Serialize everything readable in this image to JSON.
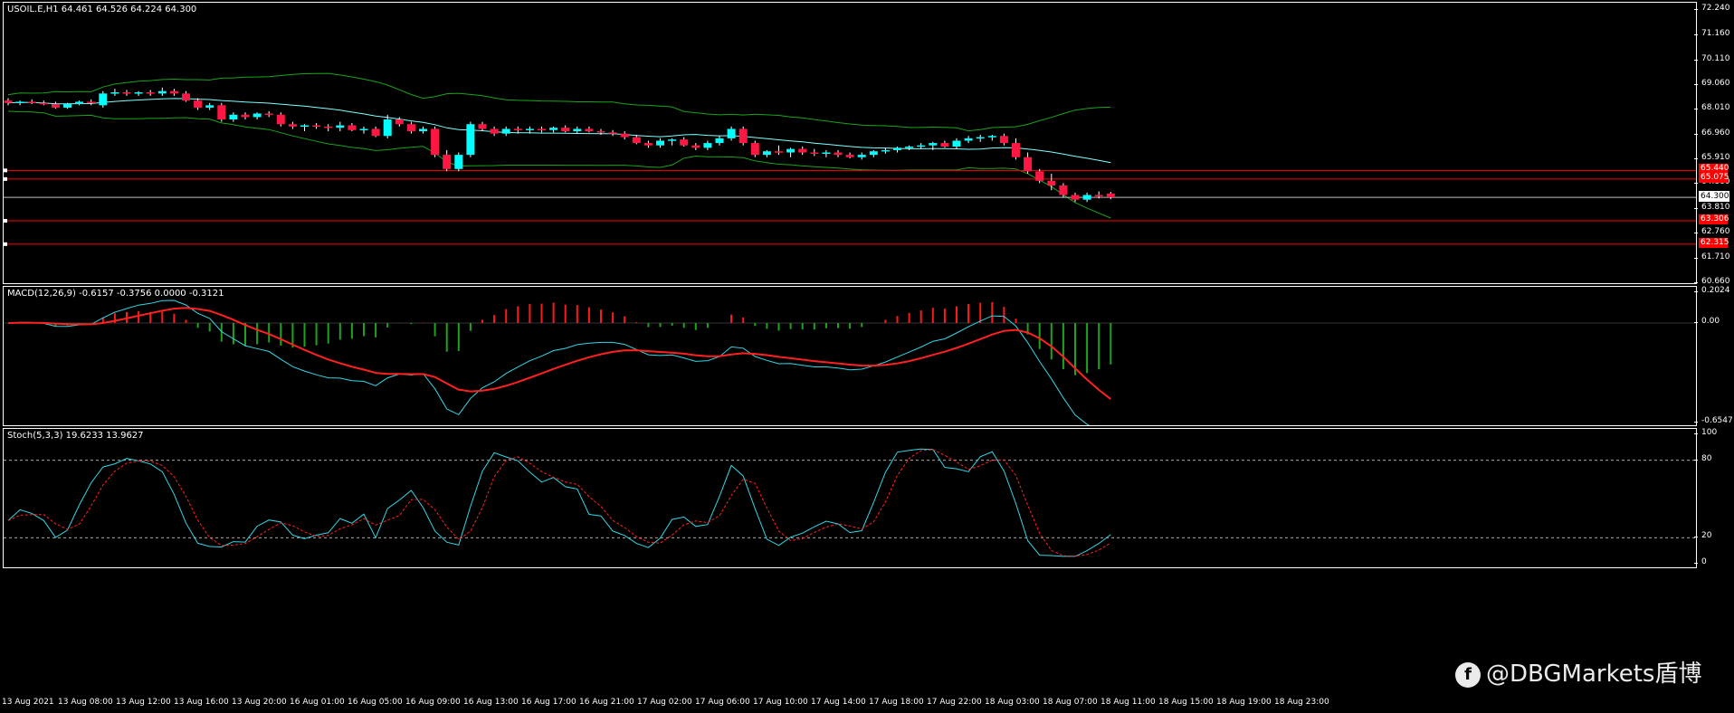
{
  "main": {
    "symbol_line": "USOIL.E,H1  64.461 64.526 64.224 64.300",
    "ticks": [
      "72.240",
      "71.160",
      "70.110",
      "69.060",
      "68.010",
      "66.960",
      "65.910",
      "64.860",
      "63.810",
      "62.760",
      "61.710",
      "60.660"
    ],
    "levels": [
      {
        "label": "65.440",
        "value": 65.44
      },
      {
        "label": "65.075",
        "value": 65.075
      },
      {
        "label": "63.306",
        "value": 63.306
      },
      {
        "label": "62.315",
        "value": 62.315
      }
    ],
    "current_price": {
      "label": "64.300",
      "value": 64.3
    },
    "colors": {
      "bull": "#00ffff",
      "bear": "#ff1744",
      "bands": "#1aa31a",
      "midline": "#7fffff",
      "level": "#ff0000"
    }
  },
  "macd": {
    "label": "MACD(12,26,9) -0.6157 -0.3756 0.0000 -0.3121",
    "ticks": [
      "0.2024",
      "0.00",
      "-0.6547"
    ]
  },
  "stoch": {
    "label": "Stoch(5,3,3) 19.6233 13.9627",
    "ticks": [
      "100",
      "80",
      "20",
      "0"
    ]
  },
  "time_labels": [
    "13 Aug 2021",
    "13 Aug 08:00",
    "13 Aug 12:00",
    "13 Aug 16:00",
    "13 Aug 20:00",
    "16 Aug 01:00",
    "16 Aug 05:00",
    "16 Aug 09:00",
    "16 Aug 13:00",
    "16 Aug 17:00",
    "16 Aug 21:00",
    "17 Aug 02:00",
    "17 Aug 06:00",
    "17 Aug 10:00",
    "17 Aug 14:00",
    "17 Aug 18:00",
    "17 Aug 22:00",
    "18 Aug 03:00",
    "18 Aug 07:00",
    "18 Aug 11:00",
    "18 Aug 15:00",
    "18 Aug 19:00",
    "18 Aug 23:00"
  ],
  "watermark": {
    "text": "@DBGMarkets盾博",
    "icon": "dbg-logo-icon"
  },
  "chart_data": {
    "type": "candlestick",
    "symbol": "USOIL.E",
    "timeframe": "H1",
    "ylim": [
      60.66,
      72.24
    ],
    "ohlc": [
      [
        68.4,
        68.5,
        68.2,
        68.3
      ],
      [
        68.3,
        68.4,
        68.2,
        68.35
      ],
      [
        68.35,
        68.45,
        68.25,
        68.3
      ],
      [
        68.3,
        68.4,
        68.2,
        68.25
      ],
      [
        68.25,
        68.35,
        68.05,
        68.1
      ],
      [
        68.1,
        68.3,
        68.05,
        68.25
      ],
      [
        68.25,
        68.4,
        68.2,
        68.35
      ],
      [
        68.35,
        68.45,
        68.2,
        68.3
      ],
      [
        68.2,
        68.8,
        68.1,
        68.7
      ],
      [
        68.7,
        68.9,
        68.6,
        68.75
      ],
      [
        68.75,
        68.85,
        68.6,
        68.7
      ],
      [
        68.7,
        68.8,
        68.6,
        68.75
      ],
      [
        68.75,
        68.85,
        68.6,
        68.7
      ],
      [
        68.7,
        68.95,
        68.6,
        68.8
      ],
      [
        68.8,
        68.9,
        68.6,
        68.7
      ],
      [
        68.7,
        68.8,
        68.35,
        68.4
      ],
      [
        68.4,
        68.5,
        68.0,
        68.1
      ],
      [
        68.1,
        68.3,
        68.0,
        68.2
      ],
      [
        68.2,
        68.3,
        67.5,
        67.6
      ],
      [
        67.6,
        67.9,
        67.5,
        67.8
      ],
      [
        67.8,
        67.9,
        67.6,
        67.7
      ],
      [
        67.7,
        67.9,
        67.6,
        67.85
      ],
      [
        67.85,
        67.95,
        67.7,
        67.8
      ],
      [
        67.8,
        67.9,
        67.3,
        67.4
      ],
      [
        67.4,
        67.5,
        67.2,
        67.3
      ],
      [
        67.3,
        67.4,
        67.1,
        67.35
      ],
      [
        67.35,
        67.45,
        67.2,
        67.3
      ],
      [
        67.3,
        67.4,
        67.1,
        67.25
      ],
      [
        67.25,
        67.5,
        67.1,
        67.35
      ],
      [
        67.35,
        67.45,
        67.1,
        67.15
      ],
      [
        67.15,
        67.3,
        67.0,
        67.2
      ],
      [
        67.2,
        67.3,
        66.85,
        66.9
      ],
      [
        66.9,
        67.8,
        66.8,
        67.6
      ],
      [
        67.6,
        67.7,
        67.3,
        67.4
      ],
      [
        67.4,
        67.5,
        67.0,
        67.1
      ],
      [
        67.1,
        67.3,
        67.0,
        67.2
      ],
      [
        67.2,
        67.3,
        66.0,
        66.1
      ],
      [
        66.1,
        66.3,
        65.4,
        65.5
      ],
      [
        65.5,
        66.2,
        65.4,
        66.1
      ],
      [
        66.1,
        67.5,
        66.0,
        67.4
      ],
      [
        67.4,
        67.5,
        67.1,
        67.2
      ],
      [
        67.2,
        67.3,
        66.9,
        67.0
      ],
      [
        67.0,
        67.3,
        66.9,
        67.2
      ],
      [
        67.2,
        67.3,
        67.0,
        67.15
      ],
      [
        67.15,
        67.3,
        67.0,
        67.2
      ],
      [
        67.2,
        67.3,
        67.05,
        67.15
      ],
      [
        67.15,
        67.3,
        67.05,
        67.25
      ],
      [
        67.25,
        67.35,
        67.05,
        67.1
      ],
      [
        67.1,
        67.3,
        67.0,
        67.2
      ],
      [
        67.2,
        67.3,
        67.05,
        67.1
      ],
      [
        67.1,
        67.2,
        66.95,
        67.05
      ],
      [
        67.05,
        67.15,
        66.9,
        67.0
      ],
      [
        67.0,
        67.1,
        66.75,
        66.85
      ],
      [
        66.85,
        66.95,
        66.55,
        66.6
      ],
      [
        66.6,
        66.7,
        66.4,
        66.5
      ],
      [
        66.5,
        66.8,
        66.4,
        66.7
      ],
      [
        66.7,
        66.8,
        66.5,
        66.75
      ],
      [
        66.75,
        66.85,
        66.45,
        66.5
      ],
      [
        66.5,
        66.6,
        66.3,
        66.4
      ],
      [
        66.4,
        66.7,
        66.3,
        66.6
      ],
      [
        66.6,
        66.9,
        66.5,
        66.8
      ],
      [
        66.8,
        67.3,
        66.7,
        67.2
      ],
      [
        67.2,
        67.3,
        66.5,
        66.6
      ],
      [
        66.6,
        66.7,
        66.0,
        66.1
      ],
      [
        66.1,
        66.3,
        66.0,
        66.25
      ],
      [
        66.25,
        66.5,
        66.1,
        66.2
      ],
      [
        66.2,
        66.4,
        66.0,
        66.35
      ],
      [
        66.35,
        66.45,
        66.1,
        66.2
      ],
      [
        66.2,
        66.35,
        66.05,
        66.15
      ],
      [
        66.15,
        66.3,
        66.0,
        66.2
      ],
      [
        66.2,
        66.3,
        66.0,
        66.1
      ],
      [
        66.1,
        66.2,
        65.95,
        66.0
      ],
      [
        66.0,
        66.2,
        65.9,
        66.1
      ],
      [
        66.1,
        66.3,
        66.0,
        66.25
      ],
      [
        66.25,
        66.4,
        66.15,
        66.3
      ],
      [
        66.3,
        66.45,
        66.2,
        66.4
      ],
      [
        66.4,
        66.5,
        66.3,
        66.45
      ],
      [
        66.45,
        66.6,
        66.35,
        66.5
      ],
      [
        66.5,
        66.65,
        66.3,
        66.6
      ],
      [
        66.6,
        66.7,
        66.4,
        66.45
      ],
      [
        66.45,
        66.8,
        66.35,
        66.7
      ],
      [
        66.7,
        66.9,
        66.6,
        66.8
      ],
      [
        66.8,
        66.95,
        66.65,
        66.85
      ],
      [
        66.85,
        66.95,
        66.7,
        66.9
      ],
      [
        66.9,
        67.0,
        66.5,
        66.6
      ],
      [
        66.6,
        66.8,
        65.9,
        66.0
      ],
      [
        66.0,
        66.2,
        65.3,
        65.4
      ],
      [
        65.4,
        65.5,
        64.9,
        65.0
      ],
      [
        65.0,
        65.3,
        64.6,
        64.8
      ],
      [
        64.8,
        64.9,
        64.3,
        64.4
      ],
      [
        64.4,
        64.5,
        64.1,
        64.2
      ],
      [
        64.2,
        64.5,
        64.1,
        64.4
      ],
      [
        64.4,
        64.55,
        64.25,
        64.35
      ],
      [
        64.46,
        64.53,
        64.22,
        64.3
      ]
    ]
  }
}
